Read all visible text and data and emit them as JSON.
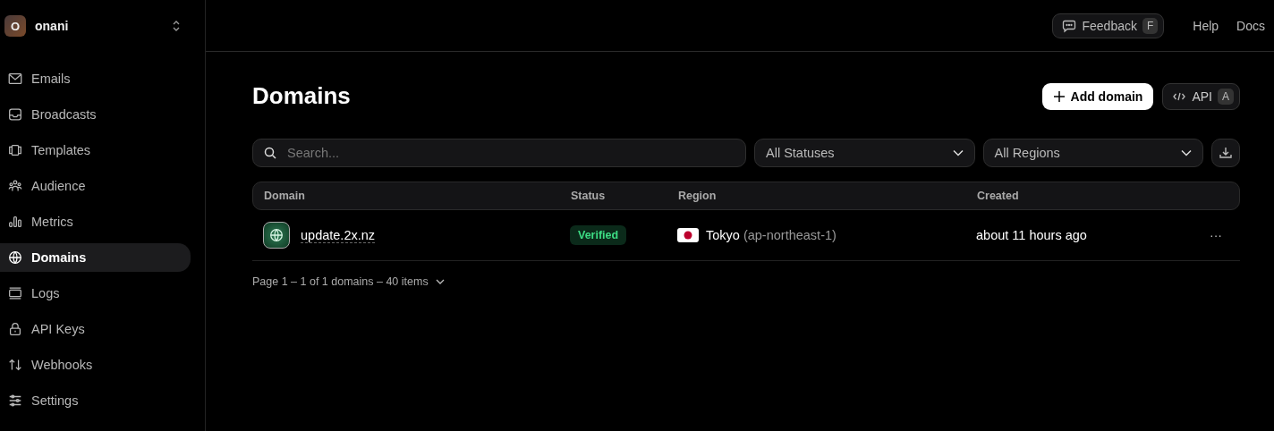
{
  "workspace": {
    "initial": "O",
    "name": "onani"
  },
  "nav": [
    {
      "label": "Emails",
      "selected": false
    },
    {
      "label": "Broadcasts",
      "selected": false
    },
    {
      "label": "Templates",
      "selected": false
    },
    {
      "label": "Audience",
      "selected": false
    },
    {
      "label": "Metrics",
      "selected": false
    },
    {
      "label": "Domains",
      "selected": true
    },
    {
      "label": "Logs",
      "selected": false
    },
    {
      "label": "API Keys",
      "selected": false
    },
    {
      "label": "Webhooks",
      "selected": false
    },
    {
      "label": "Settings",
      "selected": false
    }
  ],
  "topbar": {
    "feedback": "Feedback",
    "feedback_key": "F",
    "links": [
      "Help",
      "Docs"
    ]
  },
  "page": {
    "title": "Domains",
    "add_button": "Add domain",
    "api_button": "API",
    "api_key": "A"
  },
  "filters": {
    "search_placeholder": "Search...",
    "status": "All Statuses",
    "region": "All Regions"
  },
  "table": {
    "columns": [
      "Domain",
      "Status",
      "Region",
      "Created"
    ],
    "rows": [
      {
        "domain": "update.2x.nz",
        "status": "Verified",
        "color": "#0b2a1a",
        "region": "Tokyo",
        "region_code": "(ap-northeast-1)",
        "created": "about 11 hours ago",
        "menu": "···"
      }
    ]
  },
  "pagination": "Page 1 – 1 of 1 domains – 40 items"
}
